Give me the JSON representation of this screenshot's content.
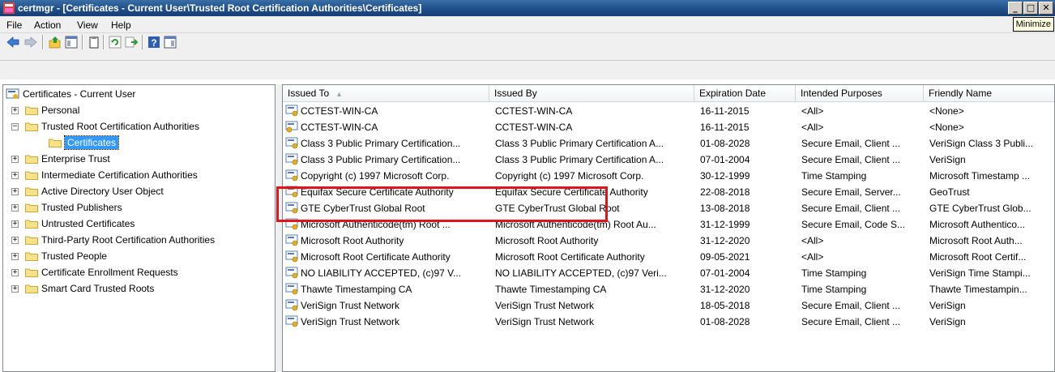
{
  "window": {
    "title": "certmgr - [Certificates - Current User\\Trusted Root Certification Authorities\\Certificates]",
    "minimize": "_",
    "maximize": "□",
    "close": "✕",
    "tooltip": "Minimize"
  },
  "menu": [
    "File",
    "Action",
    "View",
    "Help"
  ],
  "toolbar": [
    "back-arrow-icon",
    "forward-arrow-icon",
    "up-folder-icon",
    "show-hide-tree-icon",
    "clipboard-icon",
    "refresh-icon",
    "export-list-icon",
    "help-icon",
    "properties-icon"
  ],
  "tree": {
    "root": "Certificates - Current User",
    "items": [
      {
        "label": "Personal",
        "expander": "+",
        "selected": false
      },
      {
        "label": "Trusted Root Certification Authorities",
        "expander": "−",
        "selected": false
      },
      {
        "label": "Certificates",
        "expander": "",
        "selected": true
      },
      {
        "label": "Enterprise Trust",
        "expander": "+",
        "selected": false
      },
      {
        "label": "Intermediate Certification Authorities",
        "expander": "+",
        "selected": false
      },
      {
        "label": "Active Directory User Object",
        "expander": "+",
        "selected": false
      },
      {
        "label": "Trusted Publishers",
        "expander": "+",
        "selected": false
      },
      {
        "label": "Untrusted Certificates",
        "expander": "+",
        "selected": false
      },
      {
        "label": "Third-Party Root Certification Authorities",
        "expander": "+",
        "selected": false
      },
      {
        "label": "Trusted People",
        "expander": "+",
        "selected": false
      },
      {
        "label": "Certificate Enrollment Requests",
        "expander": "+",
        "selected": false
      },
      {
        "label": "Smart Card Trusted Roots",
        "expander": "+",
        "selected": false
      }
    ]
  },
  "list": {
    "columns": [
      "Issued To",
      "Issued By",
      "Expiration Date",
      "Intended Purposes",
      "Friendly Name"
    ],
    "rows": [
      {
        "issued_to": "CCTEST-WIN-CA",
        "issued_by": "CCTEST-WIN-CA",
        "expiration": "16-11-2015",
        "purposes": "<All>",
        "friendly": "<None>",
        "key": false
      },
      {
        "issued_to": "CCTEST-WIN-CA",
        "issued_by": "CCTEST-WIN-CA",
        "expiration": "16-11-2015",
        "purposes": "<All>",
        "friendly": "<None>",
        "key": true
      },
      {
        "issued_to": "Class 3 Public Primary Certification...",
        "issued_by": "Class 3 Public Primary Certification A...",
        "expiration": "01-08-2028",
        "purposes": "Secure Email, Client ...",
        "friendly": "VeriSign Class 3 Publi...",
        "key": false
      },
      {
        "issued_to": "Class 3 Public Primary Certification...",
        "issued_by": "Class 3 Public Primary Certification A...",
        "expiration": "07-01-2004",
        "purposes": "Secure Email, Client ...",
        "friendly": "VeriSign",
        "key": false
      },
      {
        "issued_to": "Copyright (c) 1997 Microsoft Corp.",
        "issued_by": "Copyright (c) 1997 Microsoft Corp.",
        "expiration": "30-12-1999",
        "purposes": "Time Stamping",
        "friendly": "Microsoft Timestamp ...",
        "key": false
      },
      {
        "issued_to": "Equifax Secure Certificate Authority",
        "issued_by": "Equifax Secure Certificate Authority",
        "expiration": "22-08-2018",
        "purposes": "Secure Email, Server...",
        "friendly": "GeoTrust",
        "key": false
      },
      {
        "issued_to": "GTE CyberTrust Global Root",
        "issued_by": "GTE CyberTrust Global Root",
        "expiration": "13-08-2018",
        "purposes": "Secure Email, Client ...",
        "friendly": "GTE CyberTrust Glob...",
        "key": false
      },
      {
        "issued_to": "Microsoft Authenticode(tm) Root ...",
        "issued_by": "Microsoft Authenticode(tm) Root Au...",
        "expiration": "31-12-1999",
        "purposes": "Secure Email, Code S...",
        "friendly": "Microsoft Authentico...",
        "key": false
      },
      {
        "issued_to": "Microsoft Root Authority",
        "issued_by": "Microsoft Root Authority",
        "expiration": "31-12-2020",
        "purposes": "<All>",
        "friendly": "Microsoft Root Auth...",
        "key": false
      },
      {
        "issued_to": "Microsoft Root Certificate Authority",
        "issued_by": "Microsoft Root Certificate Authority",
        "expiration": "09-05-2021",
        "purposes": "<All>",
        "friendly": "Microsoft Root Certif...",
        "key": false
      },
      {
        "issued_to": "NO LIABILITY ACCEPTED, (c)97 V...",
        "issued_by": "NO LIABILITY ACCEPTED, (c)97 Veri...",
        "expiration": "07-01-2004",
        "purposes": "Time Stamping",
        "friendly": "VeriSign Time Stampi...",
        "key": false
      },
      {
        "issued_to": "Thawte Timestamping CA",
        "issued_by": "Thawte Timestamping CA",
        "expiration": "31-12-2020",
        "purposes": "Time Stamping",
        "friendly": "Thawte Timestampin...",
        "key": false
      },
      {
        "issued_to": "VeriSign Trust Network",
        "issued_by": "VeriSign Trust Network",
        "expiration": "18-05-2018",
        "purposes": "Secure Email, Client ...",
        "friendly": "VeriSign",
        "key": false
      },
      {
        "issued_to": "VeriSign Trust Network",
        "issued_by": "VeriSign Trust Network",
        "expiration": "01-08-2028",
        "purposes": "Secure Email, Client ...",
        "friendly": "VeriSign",
        "key": false
      }
    ]
  },
  "colors": {
    "highlight": "#e0141a",
    "selection": "#3399ff",
    "titlebar": "#1f4f8a"
  }
}
